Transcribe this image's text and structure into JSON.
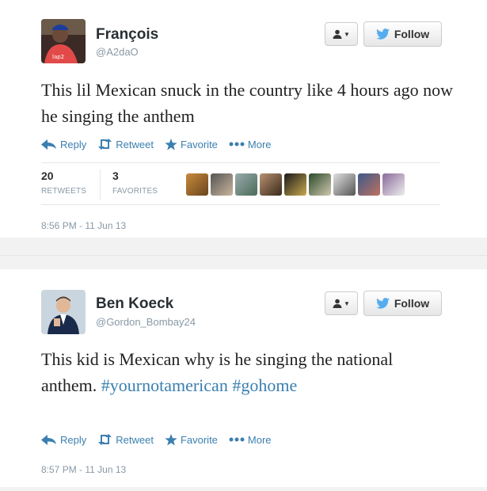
{
  "tweets": [
    {
      "name": "François",
      "handle": "@A2daO",
      "text": "This lil Mexican snuck in the country like 4 hours ago now he singing the anthem",
      "follow_label": "Follow",
      "actions": {
        "reply": "Reply",
        "retweet": "Retweet",
        "favorite": "Favorite",
        "more": "More"
      },
      "retweets_count": "20",
      "retweets_label": "RETWEETS",
      "favorites_count": "3",
      "favorites_label": "FAVORITES",
      "timestamp": "8:56 PM - 11 Jun 13"
    },
    {
      "name": "Ben Koeck",
      "handle": "@Gordon_Bombay24",
      "text_plain": "This kid is Mexican why is he singing the national anthem.",
      "hashtag_1": "#yournotamerican",
      "hashtag_2": "#gohome",
      "follow_label": "Follow",
      "actions": {
        "reply": "Reply",
        "retweet": "Retweet",
        "favorite": "Favorite",
        "more": "More"
      },
      "timestamp": "8:57 PM - 11 Jun 13"
    }
  ],
  "colors": {
    "link": "#3b7fb0",
    "muted": "#8899a6",
    "twitter_bird": "#55acee"
  },
  "retweeter_avatar_count": 9
}
